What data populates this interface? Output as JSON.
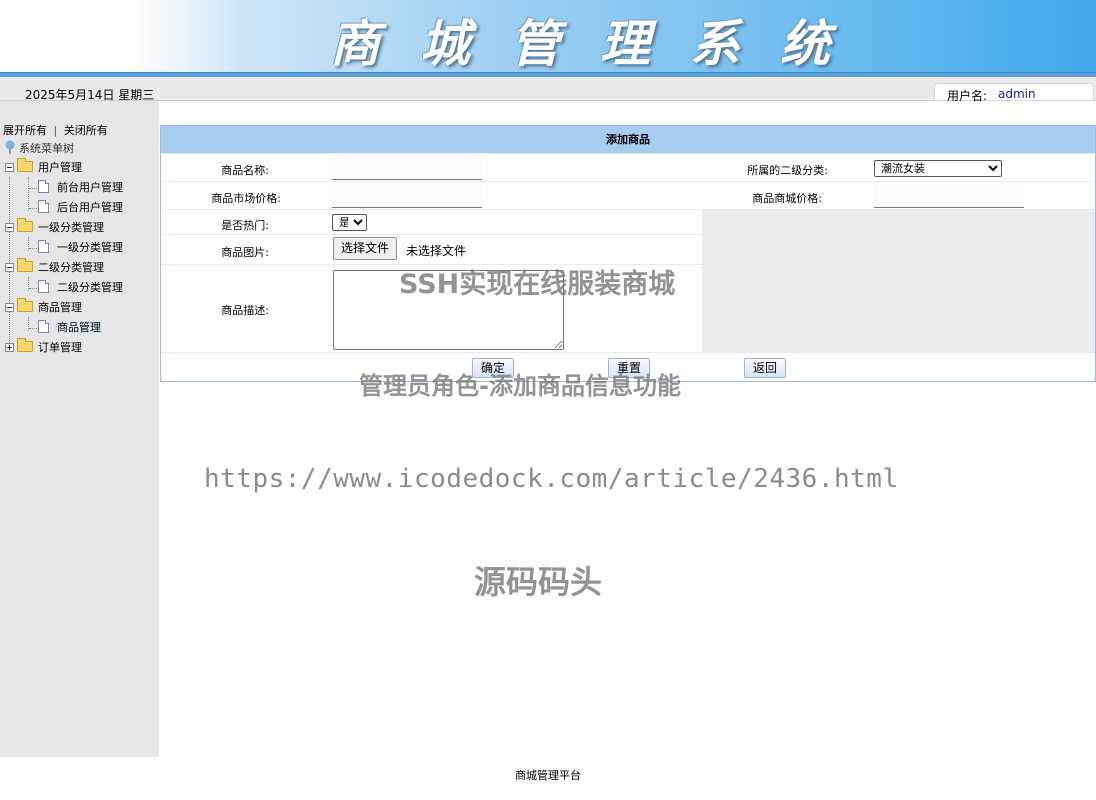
{
  "header": {
    "title": "商城管理系统"
  },
  "infobar": {
    "date": "2025年5月14日 星期三",
    "user_label": "用户名:",
    "username": "admin"
  },
  "sidebar": {
    "expand_all": "展开所有",
    "separator": "|",
    "collapse_all": "关闭所有",
    "root": "系统菜单树",
    "nodes": [
      {
        "label": "用户管理",
        "expanded": true,
        "children": [
          {
            "label": "前台用户管理"
          },
          {
            "label": "后台用户管理"
          }
        ]
      },
      {
        "label": "一级分类管理",
        "expanded": true,
        "children": [
          {
            "label": "一级分类管理"
          }
        ]
      },
      {
        "label": "二级分类管理",
        "expanded": true,
        "children": [
          {
            "label": "二级分类管理"
          }
        ]
      },
      {
        "label": "商品管理",
        "expanded": true,
        "children": [
          {
            "label": "商品管理",
            "selected": true
          }
        ]
      },
      {
        "label": "订单管理",
        "expanded": false,
        "children": []
      }
    ]
  },
  "form": {
    "title": "添加商品",
    "name_label": "商品名称:",
    "name_value": "",
    "category_label": "所属的二级分类:",
    "category_selected": "潮流女装",
    "market_price_label": "商品市场价格:",
    "market_price_value": "",
    "shop_price_label": "商品商城价格:",
    "shop_price_value": "",
    "hot_label": "是否热门:",
    "hot_selected": "是",
    "image_label": "商品图片:",
    "file_button": "选择文件",
    "file_status": "未选择文件",
    "desc_label": "商品描述:",
    "desc_value": "",
    "confirm_label": "确定",
    "reset_label": "重置",
    "back_label": "返回"
  },
  "watermarks": {
    "line1": "SSH实现在线服装商城",
    "line2": "管理员角色-添加商品信息功能",
    "line3": "https://www.icodedock.com/article/2436.html",
    "line4": "源码码头"
  },
  "footer": {
    "text": "商城管理平台"
  },
  "colors": {
    "form_header": "#a9cdf0",
    "sidebar_bg": "#e6e6e6",
    "banner_blue": "#3fa9ec"
  }
}
